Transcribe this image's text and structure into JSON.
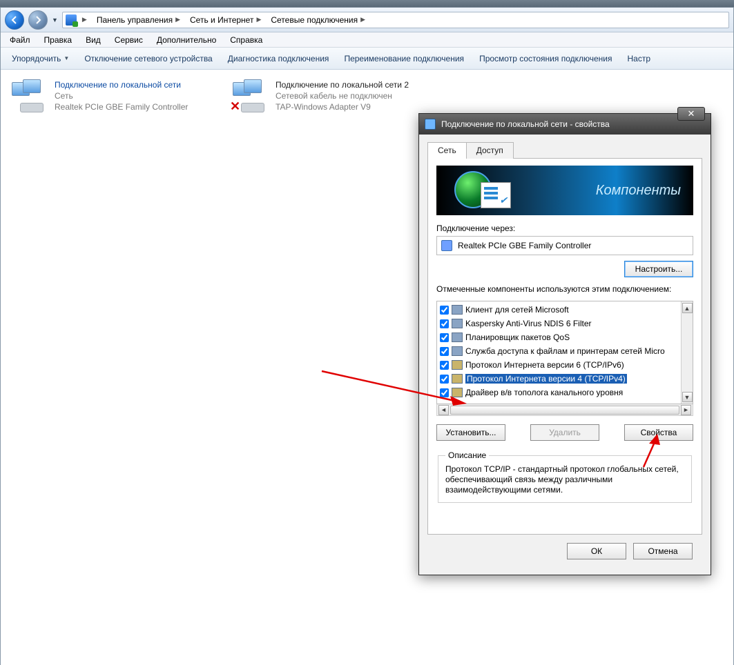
{
  "breadcrumb": {
    "seg1": "Панель управления",
    "seg2": "Сеть и Интернет",
    "seg3": "Сетевые подключения"
  },
  "menu": {
    "file": "Файл",
    "edit": "Правка",
    "view": "Вид",
    "tools": "Сервис",
    "advanced": "Дополнительно",
    "help": "Справка"
  },
  "cmdbar": {
    "organize": "Упорядочить",
    "disable": "Отключение сетевого устройства",
    "diagnose": "Диагностика подключения",
    "rename": "Переименование подключения",
    "status": "Просмотр состояния подключения",
    "settings": "Настр"
  },
  "connections": [
    {
      "title": "Подключение по локальной сети",
      "line2": "Сеть",
      "line3": "Realtek PCIe GBE Family Controller",
      "disconnected": false
    },
    {
      "title": "Подключение по локальной сети 2",
      "line2": "Сетевой кабель не подключен",
      "line3": "TAP-Windows Adapter V9",
      "disconnected": true
    }
  ],
  "dialog": {
    "title": "Подключение по локальной сети - свойства",
    "tab_network": "Сеть",
    "tab_sharing": "Доступ",
    "banner": "Компоненты",
    "connect_using": "Подключение через:",
    "adapter": "Realtek PCIe GBE Family Controller",
    "configure": "Настроить...",
    "components_label": "Отмеченные компоненты используются этим подключением:",
    "components": [
      {
        "checked": true,
        "label": "Клиент для сетей Microsoft"
      },
      {
        "checked": true,
        "label": "Kaspersky Anti-Virus NDIS 6 Filter"
      },
      {
        "checked": true,
        "label": "Планировщик пакетов QoS"
      },
      {
        "checked": true,
        "label": "Служба доступа к файлам и принтерам сетей Micro"
      },
      {
        "checked": true,
        "label": "Протокол Интернета версии 6 (TCP/IPv6)"
      },
      {
        "checked": true,
        "label": "Протокол Интернета версии 4 (TCP/IPv4)",
        "selected": true
      },
      {
        "checked": true,
        "label": "Драйвер в/в тополога канального уровня"
      }
    ],
    "install": "Установить...",
    "uninstall": "Удалить",
    "properties": "Свойства",
    "desc_title": "Описание",
    "desc_text": "Протокол TCP/IP - стандартный протокол глобальных сетей, обеспечивающий связь между различными взаимодействующими сетями.",
    "ok": "ОК",
    "cancel": "Отмена"
  }
}
